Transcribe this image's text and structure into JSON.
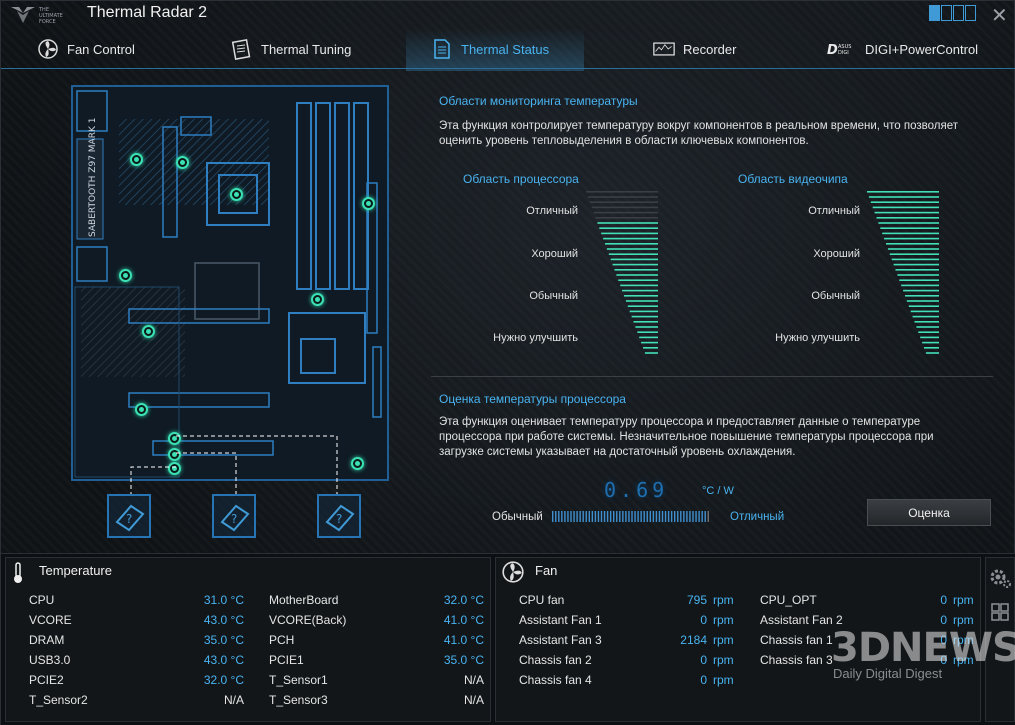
{
  "app": {
    "title": "Thermal Radar 2",
    "logo_text": "THE ULTIMATE FORCE"
  },
  "tabs": [
    {
      "label": "Fan Control",
      "icon": "fan-icon",
      "active": false
    },
    {
      "label": "Thermal Tuning",
      "icon": "tuning-icon",
      "active": false
    },
    {
      "label": "Thermal Status",
      "icon": "document-icon",
      "active": true
    },
    {
      "label": "Recorder",
      "icon": "recorder-icon",
      "active": false
    },
    {
      "label": "DIGI+PowerControl",
      "icon": "digi-icon",
      "active": false
    }
  ],
  "board": {
    "model_text": "SABERTOOTH Z97 MARK 1"
  },
  "monitor": {
    "title": "Области мониторинга температуры",
    "desc1": "Эта функция контролирует температуру вокруг компонентов в реальном времени, что позволяет",
    "desc2": "оценить уровень тепловыделения в области ключевых компонентов.",
    "cpu_area": "Область процессора",
    "gpu_area": "Область видеочипа",
    "levels": [
      "Отличный",
      "Хороший",
      "Обычный",
      "Нужно улучшить"
    ]
  },
  "estimate": {
    "title": "Оценка температуры процессора",
    "desc1": "Эта функция оценивает температуру процессора и предоставляет данные о температуре",
    "desc2": "процессора при работе системы. Незначительное повышение температуры процессора при",
    "desc3": "загрузке системы указывает на достаточный уровень охлаждения.",
    "value": "0.69",
    "unit": "°C / W",
    "scale_left": "Обычный",
    "scale_right": "Отличный",
    "button": "Оценка"
  },
  "temperature": {
    "title": "Temperature",
    "left": [
      {
        "name": "CPU",
        "value": "31.0 °C"
      },
      {
        "name": "VCORE",
        "value": "43.0 °C"
      },
      {
        "name": "DRAM",
        "value": "35.0 °C"
      },
      {
        "name": "USB3.0",
        "value": "43.0 °C"
      },
      {
        "name": "PCIE2",
        "value": "32.0 °C"
      },
      {
        "name": "T_Sensor2",
        "value": "N/A"
      }
    ],
    "right": [
      {
        "name": "MotherBoard",
        "value": "32.0 °C"
      },
      {
        "name": "VCORE(Back)",
        "value": "41.0 °C"
      },
      {
        "name": "PCH",
        "value": "41.0 °C"
      },
      {
        "name": "PCIE1",
        "value": "35.0 °C"
      },
      {
        "name": "T_Sensor1",
        "value": "N/A"
      },
      {
        "name": "T_Sensor3",
        "value": "N/A"
      }
    ]
  },
  "fan": {
    "title": "Fan",
    "unit": "rpm",
    "left": [
      {
        "name": "CPU fan",
        "value": "795"
      },
      {
        "name": "Assistant Fan 1",
        "value": "0"
      },
      {
        "name": "Assistant Fan 3",
        "value": "2184"
      },
      {
        "name": "Chassis fan 2",
        "value": "0"
      },
      {
        "name": "Chassis fan 4",
        "value": "0"
      }
    ],
    "right": [
      {
        "name": "CPU_OPT",
        "value": "0"
      },
      {
        "name": "Assistant Fan 2",
        "value": "0"
      },
      {
        "name": "Chassis fan 1",
        "value": "0"
      },
      {
        "name": "Chassis fan 3",
        "value": "0"
      }
    ]
  },
  "watermark": {
    "brand": "3DNEWS",
    "tagline": "Daily Digital Digest"
  },
  "colors": {
    "accent": "#49b3f0",
    "sensor": "#3be0b4",
    "board": "#1f5f95"
  }
}
